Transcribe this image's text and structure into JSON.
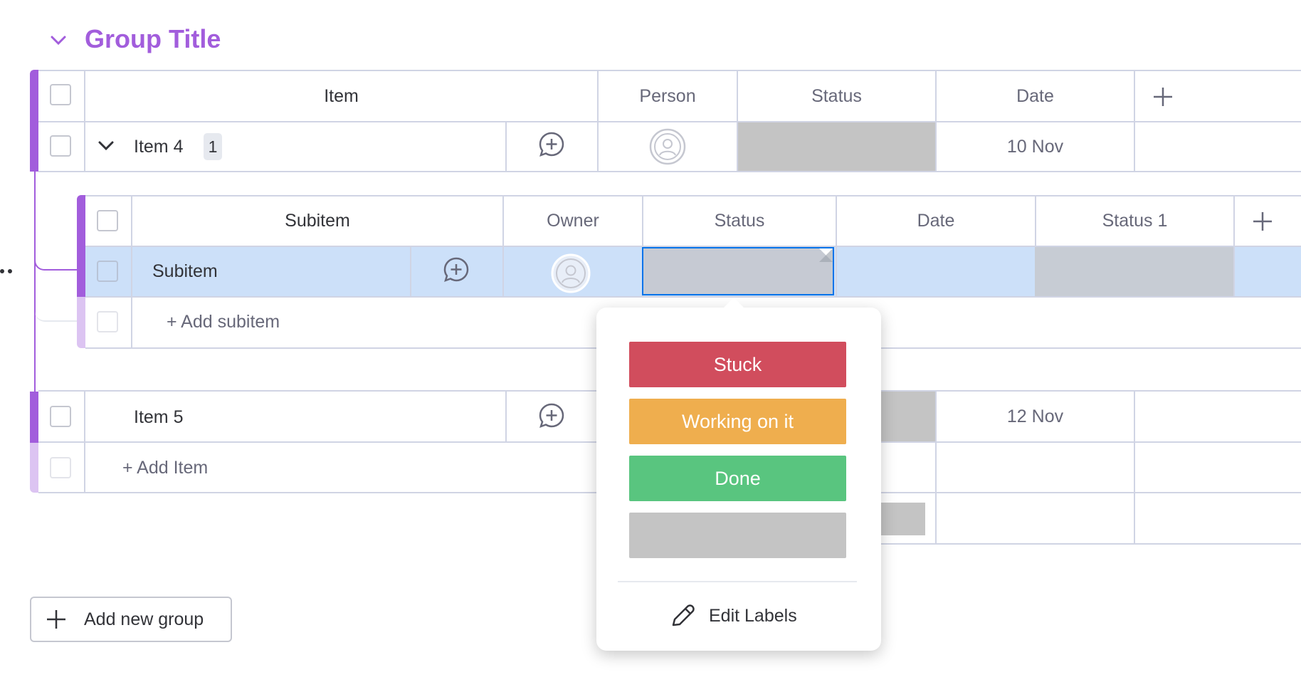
{
  "group": {
    "title": "Group Title",
    "color": "#a25ddc"
  },
  "columns": [
    "Item",
    "Person",
    "Status",
    "Date"
  ],
  "items": [
    {
      "name": "Item 4",
      "subitem_count": "1",
      "date": "10 Nov"
    },
    {
      "name": "Item 5",
      "date": "12 Nov"
    }
  ],
  "add_item_label": "+ Add Item",
  "subitem_table": {
    "columns": [
      "Subitem",
      "Owner",
      "Status",
      "Date",
      "Status 1"
    ],
    "rows": [
      {
        "name": "Subitem"
      }
    ],
    "add_subitem_label": "+ Add subitem"
  },
  "status_popup": {
    "options": [
      {
        "label": "Stuck",
        "color": "#d14d5d"
      },
      {
        "label": "Working on it",
        "color": "#efae4e"
      },
      {
        "label": "Done",
        "color": "#59c57f"
      },
      {
        "label": "",
        "color": "#c4c4c4"
      }
    ],
    "edit_labels": "Edit Labels"
  },
  "add_new_group_label": "Add new group",
  "icons": [
    "chevron-down-icon",
    "add-update-icon",
    "person-icon",
    "plus-icon",
    "pencil-icon"
  ]
}
